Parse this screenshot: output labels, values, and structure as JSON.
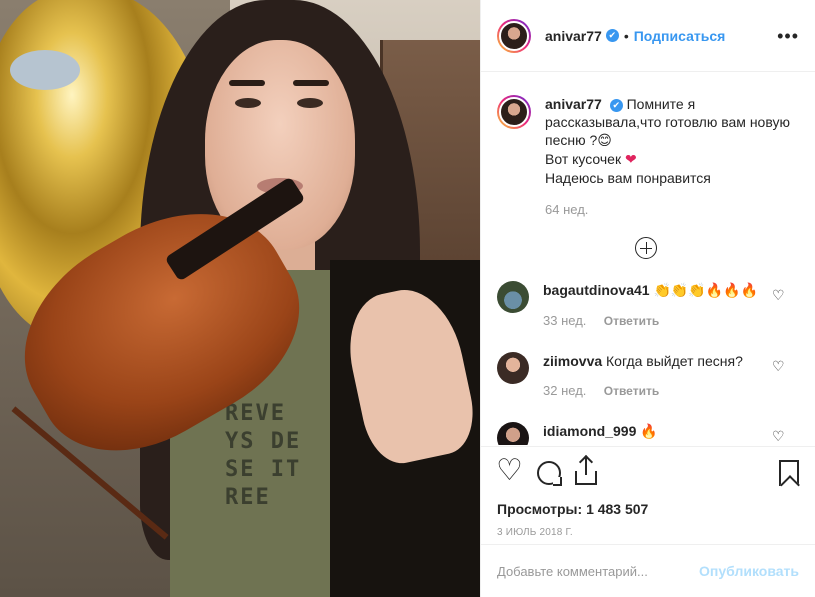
{
  "post": {
    "username": "anivar77",
    "verified_mark": "✔",
    "separator": "•",
    "follow_label": "Подписаться",
    "more_label": "•••"
  },
  "caption": {
    "username": "anivar77",
    "line1": "Помните я рассказывала,что готовлю вам новую песню ?",
    "line1_emoji": "😊",
    "line2": "Вот кусочек",
    "line2_emoji": "❤",
    "line3": "Надеюсь вам понравится",
    "time": "64 нед.",
    "load_more_icon": "plus-circle-icon"
  },
  "comments": [
    {
      "username": "bagautdinova41",
      "text": "👏👏👏🔥🔥🔥",
      "time": "33 нед.",
      "reply_label": "Ответить"
    },
    {
      "username": "ziimovva",
      "text": "Когда выйдет песня?",
      "time": "32 нед.",
      "reply_label": "Ответить"
    },
    {
      "username": "idiamond_999",
      "text": "🔥",
      "time": "",
      "reply_label": ""
    }
  ],
  "media": {
    "shirt_text": "REVE\nYS DE\nSE IT\nREE"
  },
  "actions": {
    "icons": [
      "heart-icon",
      "comment-icon",
      "share-icon",
      "bookmark-icon"
    ],
    "views_label": "Просмотры:",
    "views_count": "1 483 507",
    "date": "3 июль 2018 г."
  },
  "add_comment": {
    "placeholder": "Добавьте комментарий...",
    "publish_label": "Опубликовать"
  },
  "colors": {
    "accent": "#3897f0",
    "publish_disabled": "#b2dffc",
    "muted": "#999999"
  }
}
